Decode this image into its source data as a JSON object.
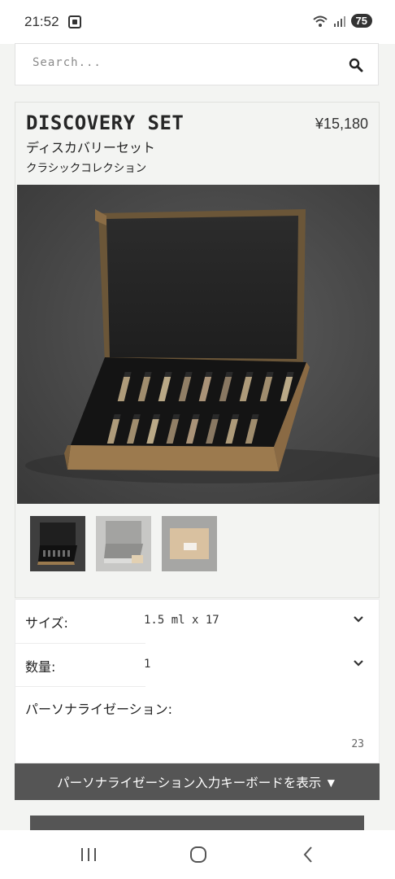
{
  "status": {
    "time": "21:52",
    "battery": "75"
  },
  "search": {
    "placeholder": "Search..."
  },
  "product": {
    "title": "DISCOVERY SET",
    "price": "¥15,180",
    "subtitle_ja": "ディスカバリーセット",
    "collection": "クラシックコレクション",
    "image": {
      "caption": "Kraft box with black foam insert holding 17 sample vials",
      "vials": 17
    },
    "thumbnails": [
      {
        "name": "thumb-open-box-dark"
      },
      {
        "name": "thumb-open-box-light"
      },
      {
        "name": "thumb-closed-box"
      }
    ]
  },
  "options": {
    "size": {
      "label": "サイズ:",
      "value": "1.5 ml x 17"
    },
    "quantity": {
      "label": "数量:",
      "value": "1"
    },
    "personalization": {
      "label": "パーソナライゼーション:",
      "char_count": "23"
    }
  },
  "keyboard_button": {
    "label": "パーソナライゼーション入力キーボードを表示 ▼"
  },
  "colors": {
    "accent_dark": "#555555",
    "background": "#f3f4f2"
  },
  "icons": [
    "screenshot-icon",
    "wifi-icon",
    "signal-icon",
    "search-icon",
    "chevron-down-icon",
    "recents-icon",
    "home-icon",
    "back-icon"
  ]
}
